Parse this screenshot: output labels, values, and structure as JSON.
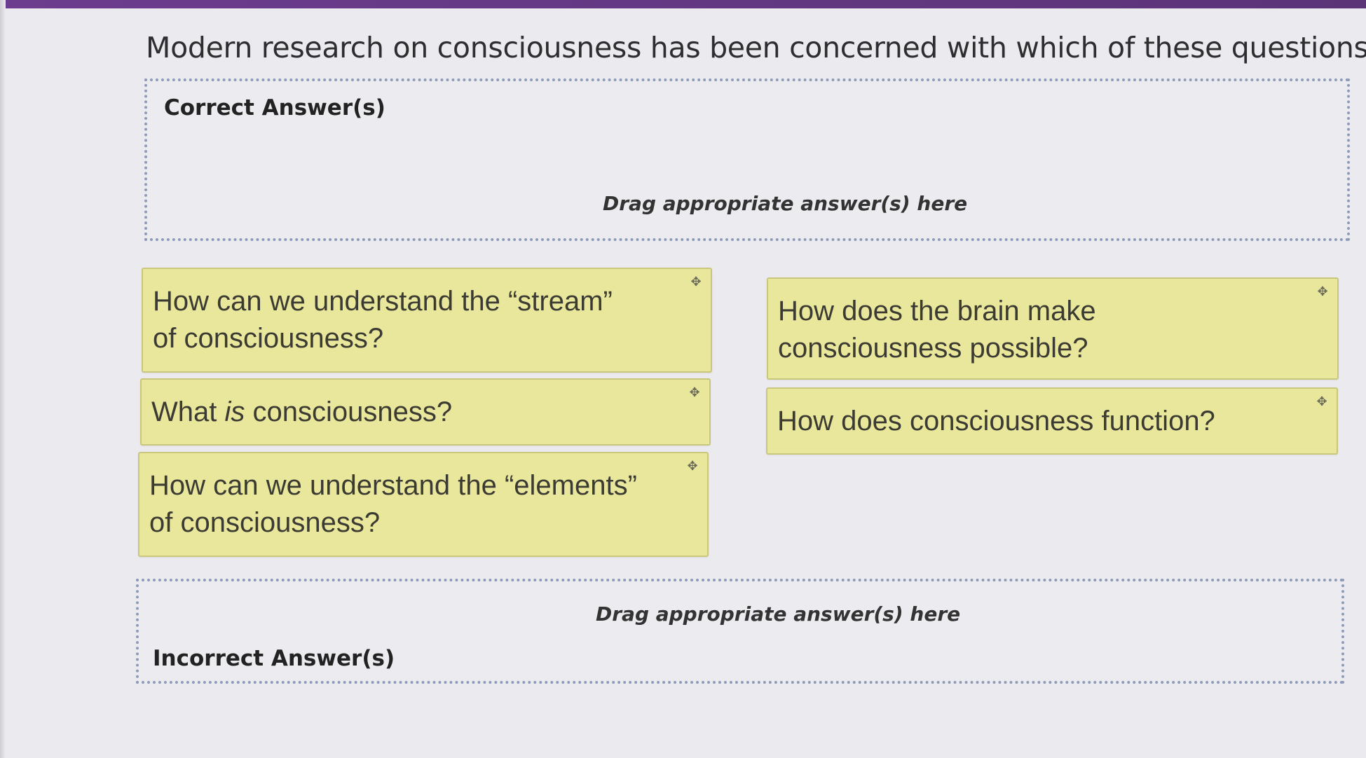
{
  "question": {
    "text": "Modern research on consciousness has been concerned with which of these questions?"
  },
  "correct_zone": {
    "title": "Correct Answer(s)",
    "hint": "Drag appropriate answer(s) here"
  },
  "incorrect_zone": {
    "title": "Incorrect Answer(s)",
    "hint": "Drag appropriate answer(s) here"
  },
  "cards": [
    {
      "text": "How can we understand the “stream” of consciousness?"
    },
    {
      "text_before": "What ",
      "text_emph": "is",
      "text_after": " consciousness?"
    },
    {
      "text": "How can we understand the “elements” of consciousness?"
    },
    {
      "text": "How does the brain make consciousness possible?"
    },
    {
      "text": "How does consciousness function?"
    }
  ],
  "icons": {
    "move": "move-icon"
  },
  "colors": {
    "card_background": "#e9e79b",
    "top_bar": "#6c3c8e",
    "dropzone_border": "#8e9bb8"
  }
}
